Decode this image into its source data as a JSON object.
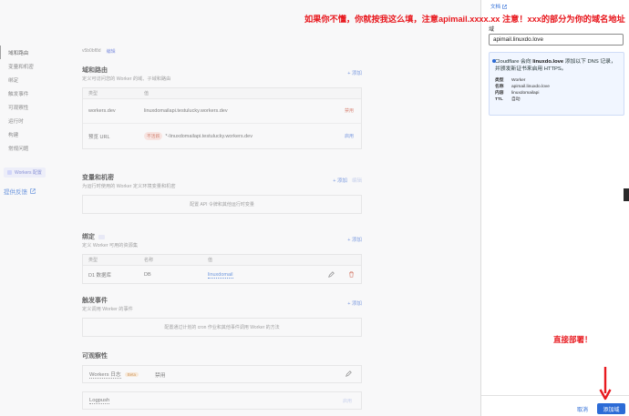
{
  "annotations": {
    "top_note": "如果你不懂，你就按我这么填，注意apimail.xxxx.xx 注意！xxx的部分为你的域名地址",
    "deploy_note": "直接部署！"
  },
  "left_nav": {
    "items": [
      "域和路由",
      "变量和机密",
      "绑定",
      "触发事件",
      "可观察性",
      "运行时",
      "构建",
      "常规问题"
    ],
    "workers_config": "Workers 配置",
    "feedback": "提供反馈"
  },
  "main": {
    "top_id": "v5b0bf8d",
    "top_edit": "编辑",
    "domains": {
      "title": "域和路由",
      "desc": "定义可访问您的 Worker 的域、子域和路由",
      "add": "+ 添加",
      "headers": [
        "类型",
        "值"
      ],
      "rows": [
        {
          "type": "workers.dev",
          "value": "linuxdomailapi.testulucky.workers.dev",
          "action": "禁用",
          "action2": ""
        },
        {
          "type": "预览 URL",
          "badge": "不活跃",
          "value": "*-linuxdomailapi.testulucky.workers.dev",
          "action": "启用",
          "action2": ""
        }
      ]
    },
    "vars": {
      "title": "变量和机密",
      "desc": "为运行时使用的 Worker 定义环境变量和机密",
      "add": "+ 添加",
      "edit": "编辑",
      "empty": "配置 API 令牌和其他运行时变量"
    },
    "bindings": {
      "title": "绑定",
      "desc": "定义 Worker 可用的资源集",
      "add": "+ 添加",
      "headers": [
        "类型",
        "名称",
        "值"
      ],
      "rows": [
        {
          "type": "D1 数据库",
          "name": "DB",
          "value": "linuxdomail"
        }
      ]
    },
    "triggers": {
      "title": "触发事件",
      "desc": "定义调用 Worker 的事件",
      "add": "+ 添加",
      "empty": "配置通过计划的 cron 作业和其他事件调用 Worker 的方法"
    },
    "observability": {
      "title": "可观察性",
      "rows": [
        {
          "label": "Workers 日志",
          "beta": "Beta",
          "status": "禁用"
        },
        {
          "label": "Logpush",
          "right": "启用"
        }
      ]
    }
  },
  "drawer": {
    "doc_link": "文档",
    "field_label": "域",
    "field_value": "apimail.linuxdo.love",
    "info_prefix": "Cloudflare 会向 ",
    "info_domain": "linuxdo.love",
    "info_suffix": " 添加以下 DNS 记录，并颁发新证书来启用 HTTPS。",
    "records": [
      {
        "k": "类型",
        "v": "Worker"
      },
      {
        "k": "名称",
        "v": "apimail.linuxdo.love"
      },
      {
        "k": "内容",
        "v": "linuxdomailapi"
      },
      {
        "k": "TTL",
        "v": "自动"
      }
    ],
    "cancel": "取消",
    "submit": "添加域"
  },
  "colors": {
    "accent": "#2c6bd6",
    "annotation": "#e8191f",
    "info_bg": "#f1f6ff"
  }
}
